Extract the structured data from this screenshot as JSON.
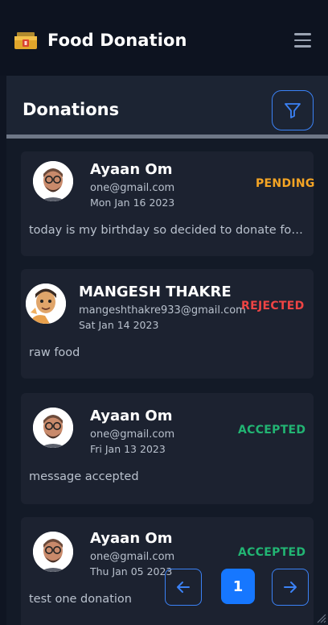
{
  "app": {
    "title": "Food Donation"
  },
  "panel": {
    "title": "Donations"
  },
  "donations": [
    {
      "name": "Ayaan Om",
      "email": "one@gmail.com",
      "date": "Mon Jan 16 2023",
      "status": "PENDING",
      "message": "today is my birthday so decided to donate food. ..."
    },
    {
      "name": "MANGESH THAKRE",
      "email": "mangeshthakre933@gmail.com",
      "date": "Sat Jan 14 2023",
      "status": "REJECTED",
      "message": "raw food"
    },
    {
      "name": "Ayaan Om",
      "email": "one@gmail.com",
      "date": "Fri Jan 13 2023",
      "status": "ACCEPTED",
      "message": "message accepted"
    },
    {
      "name": "Ayaan Om",
      "email": "one@gmail.com",
      "date": "Thu Jan 05 2023",
      "status": "ACCEPTED",
      "message": "test one donation"
    }
  ],
  "pagination": {
    "current_page": "1"
  },
  "colors": {
    "accent": "#3b82f6",
    "pending": "#f5a524",
    "rejected": "#ef4444",
    "accepted": "#22b573"
  },
  "icons": {
    "brand": "donation-box-icon",
    "menu": "hamburger-menu-icon",
    "filter": "filter-funnel-icon",
    "prev": "arrow-left-icon",
    "next": "arrow-right-icon"
  }
}
